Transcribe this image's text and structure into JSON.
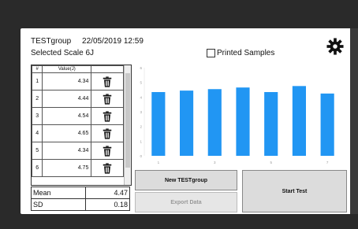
{
  "header": {
    "group_name": "TESTgroup",
    "datetime": "22/05/2019 12:59",
    "scale_label": "Selected Scale",
    "scale_value": "6J",
    "printed_label": "Printed Samples",
    "printed_checked": false
  },
  "table": {
    "columns": [
      "#",
      "Value(J)"
    ],
    "rows": [
      {
        "index": "1",
        "value": "4.34"
      },
      {
        "index": "2",
        "value": "4.44"
      },
      {
        "index": "3",
        "value": "4.54"
      },
      {
        "index": "4",
        "value": "4.65"
      },
      {
        "index": "5",
        "value": "4.34"
      },
      {
        "index": "6",
        "value": "4.75"
      }
    ]
  },
  "stats": {
    "mean_label": "Mean",
    "mean_value": "4.47",
    "sd_label": "SD",
    "sd_value": "0.18"
  },
  "chart_data": {
    "type": "bar",
    "categories": [
      "1",
      "2",
      "3",
      "4",
      "5",
      "6",
      "7"
    ],
    "x_tick_labels": [
      "1",
      "",
      "3",
      "",
      "5",
      "",
      "7"
    ],
    "values": [
      4.34,
      4.44,
      4.54,
      4.65,
      4.34,
      4.75,
      4.24
    ],
    "ylim": [
      0,
      6
    ],
    "y_ticks": [
      "0",
      "1",
      "2",
      "3",
      "4",
      "5",
      "6"
    ],
    "bar_color": "#2196f3",
    "grid": false
  },
  "buttons": {
    "new_group": "New TESTgroup",
    "export": "Export Data",
    "start": "Start Test"
  },
  "icons": {
    "settings": "gear-icon",
    "delete": "trash-icon"
  }
}
